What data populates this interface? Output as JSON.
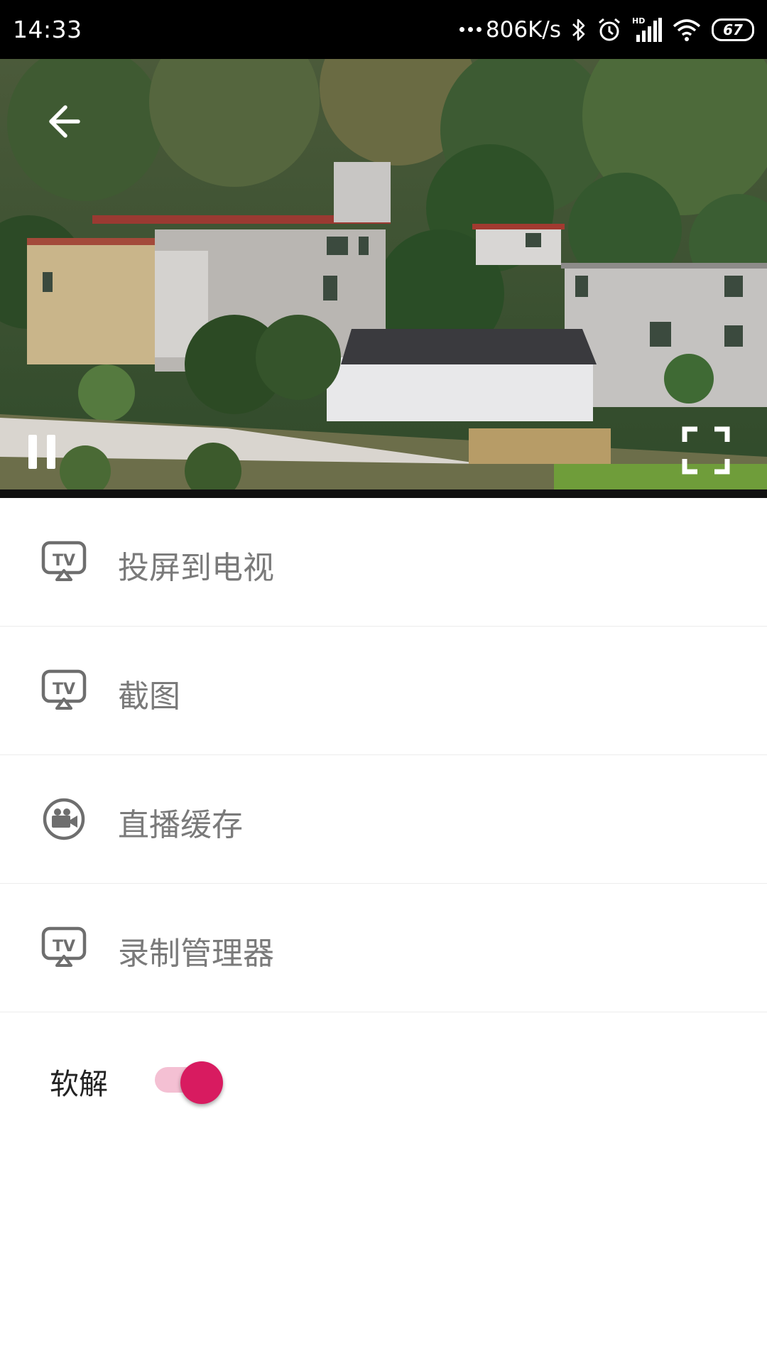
{
  "status_bar": {
    "time": "14:33",
    "net_speed": "806K/s",
    "battery": "67",
    "battery_level": 0.67,
    "icons": [
      "dots-icon",
      "bluetooth-icon",
      "alarm-icon",
      "hd-signal-icon",
      "wifi-icon",
      "battery-icon"
    ],
    "signal_badge": "HD"
  },
  "video": {
    "controls": [
      "back-arrow-icon",
      "pause-icon",
      "fullscreen-icon"
    ]
  },
  "menu": {
    "items": [
      {
        "label": "投屏到电视",
        "icon": "tv-cast-icon"
      },
      {
        "label": "截图",
        "icon": "tv-cast-icon"
      },
      {
        "label": "直播缓存",
        "icon": "video-camera-icon"
      },
      {
        "label": "录制管理器",
        "icon": "tv-cast-icon"
      }
    ]
  },
  "decoder": {
    "label": "软解",
    "enabled": true,
    "accent_color": "#d81b60",
    "track_color": "#f4c0d3"
  }
}
